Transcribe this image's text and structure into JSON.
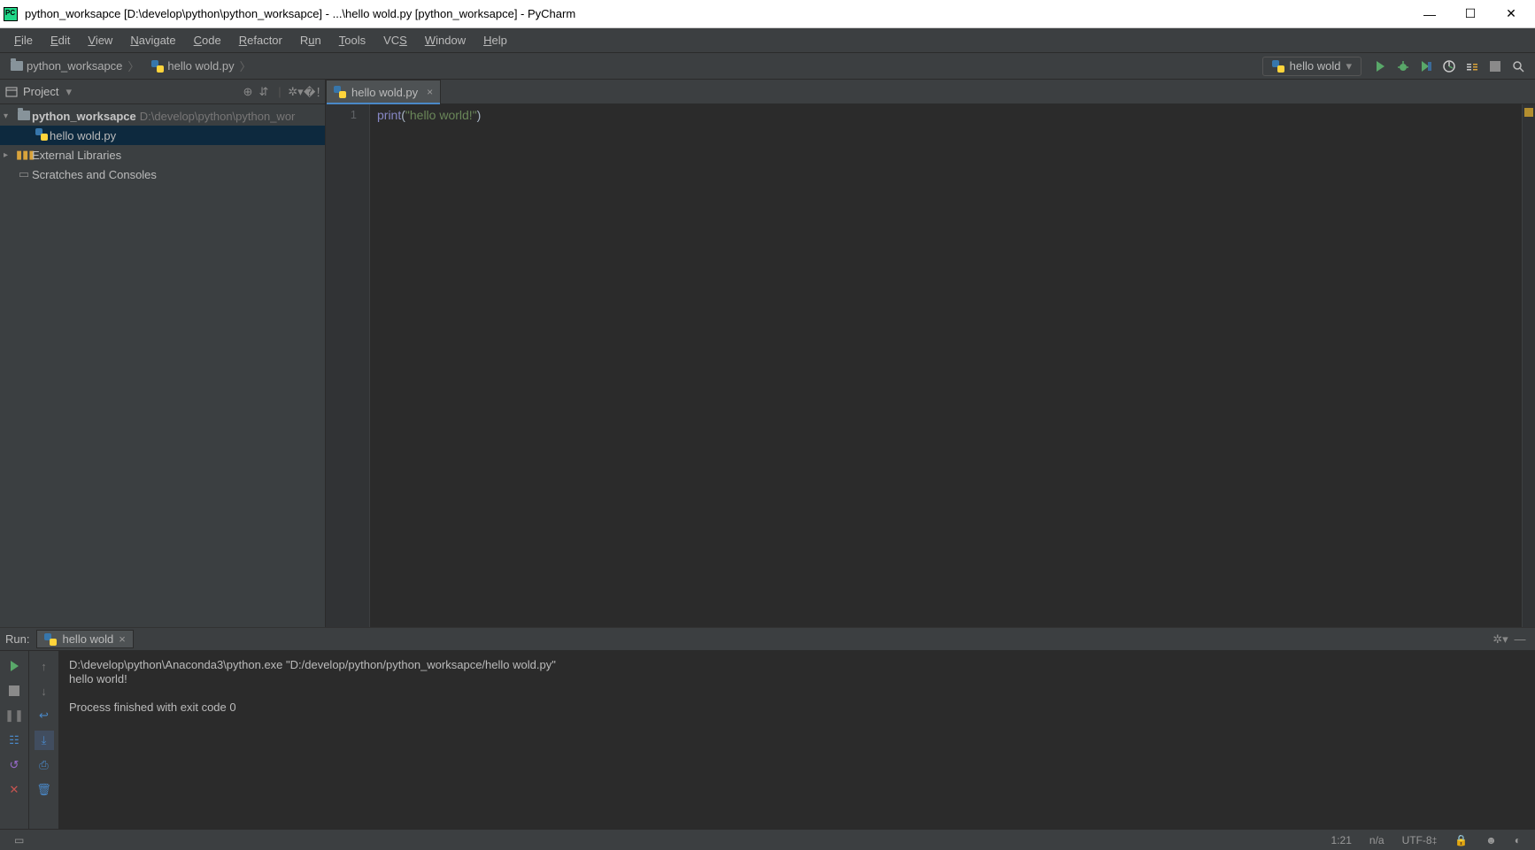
{
  "window": {
    "title": "python_worksapce [D:\\develop\\python\\python_worksapce] - ...\\hello wold.py [python_worksapce] - PyCharm"
  },
  "menubar": [
    "File",
    "Edit",
    "View",
    "Navigate",
    "Code",
    "Refactor",
    "Run",
    "Tools",
    "VCS",
    "Window",
    "Help"
  ],
  "breadcrumb": {
    "root": "python_worksapce",
    "file": "hello wold.py"
  },
  "run_config": {
    "selected": "hello wold"
  },
  "project": {
    "title": "Project",
    "root": {
      "name": "python_worksapce",
      "path": "D:\\develop\\python\\python_wor"
    },
    "file": "hello wold.py",
    "external": "External Libraries",
    "scratches": "Scratches and Consoles"
  },
  "editor": {
    "tab": "hello wold.py",
    "line_number": "1",
    "code_fn": "print",
    "code_open": "(",
    "code_str": "\"hello world!\"",
    "code_close": ")"
  },
  "run": {
    "header_label": "Run:",
    "tab": "hello wold",
    "console_line1": "D:\\develop\\python\\Anaconda3\\python.exe \"D:/develop/python/python_worksapce/hello wold.py\"",
    "console_line2": "hello world!",
    "console_line3": "",
    "console_line4": "Process finished with exit code 0"
  },
  "statusbar": {
    "caret": "1:21",
    "na": "n/a",
    "encoding": "UTF-8",
    "encoding_suffix": "‡"
  }
}
